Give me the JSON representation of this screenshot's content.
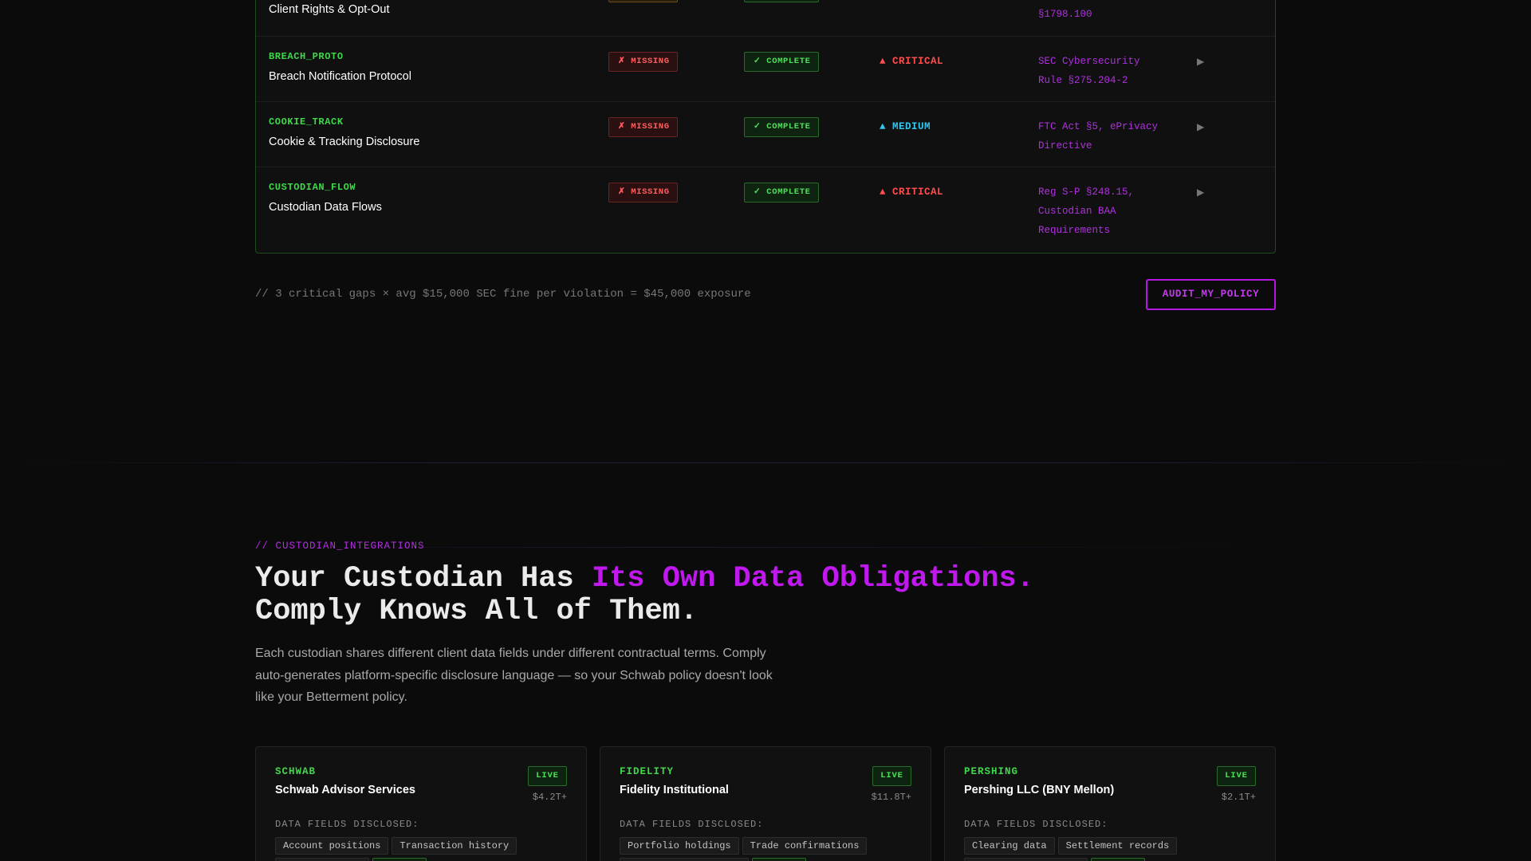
{
  "gap_table": {
    "rows": [
      {
        "code": "",
        "name": "Client Rights & Opt-Out",
        "presence_status": "",
        "completeness_status": "",
        "severity": "",
        "regulation_tail": "§1798.100"
      },
      {
        "code": "BREACH_PROTO",
        "name": "Breach Notification Protocol",
        "presence_status": "✗ MISSING",
        "completeness_status": "✓ COMPLETE",
        "severity": "▲ CRITICAL",
        "regulation": [
          "SEC Cybersecurity",
          "Rule §275.204-2"
        ],
        "expand_glyph": "▶"
      },
      {
        "code": "COOKIE_TRACK",
        "name": "Cookie & Tracking Disclosure",
        "presence_status": "✗ MISSING",
        "completeness_status": "✓ COMPLETE",
        "severity": "▲ MEDIUM",
        "regulation": [
          "FTC Act §5, ePrivacy",
          "Directive"
        ],
        "expand_glyph": "▶"
      },
      {
        "code": "CUSTODIAN_FLOW",
        "name": "Custodian Data Flows",
        "presence_status": "✗ MISSING",
        "completeness_status": "✓ COMPLETE",
        "severity": "▲ CRITICAL",
        "regulation": [
          "Reg S-P §248.15,",
          "Custodian BAA",
          "Requirements"
        ],
        "expand_glyph": "▶"
      }
    ]
  },
  "exposure_note": "// 3 critical gaps × avg $15,000 SEC fine per violation = $45,000 exposure",
  "audit_button_label": "AUDIT_MY_POLICY",
  "section": {
    "eyebrow": "// CUSTODIAN_INTEGRATIONS",
    "headline_part1": "Your Custodian Has ",
    "headline_accent": "Its Own Data Obligations.",
    "headline_line2": "Comply Knows All of Them.",
    "lede": "Each custodian shares different client data fields under different contractual terms. Comply auto-generates platform-specific disclosure language — so your Schwab policy doesn't look like your Betterment policy."
  },
  "custodians": [
    {
      "code": "SCHWAB",
      "name": "Schwab Advisor Services",
      "status": "LIVE",
      "aum": "$4.2T+",
      "fields_label": "DATA FIELDS DISCLOSED:",
      "fields": [
        "Account positions",
        "Transaction history"
      ]
    },
    {
      "code": "FIDELITY",
      "name": "Fidelity Institutional",
      "status": "LIVE",
      "aum": "$11.8T+",
      "fields_label": "DATA FIELDS DISCLOSED:",
      "fields": [
        "Portfolio holdings",
        "Trade confirmations"
      ]
    },
    {
      "code": "PERSHING",
      "name": "Pershing LLC (BNY Mellon)",
      "status": "LIVE",
      "aum": "$2.1T+",
      "fields_label": "DATA FIELDS DISCLOSED:",
      "fields": [
        "Clearing data",
        "Settlement records"
      ]
    }
  ],
  "colors": {
    "background": "#0b0b0b",
    "code_green": "#3fd84a",
    "accent_purple": "#c018ef",
    "critical_red": "#ff4d4d",
    "medium_blue": "#33c7f0",
    "regulation_purple": "#b030e0"
  }
}
